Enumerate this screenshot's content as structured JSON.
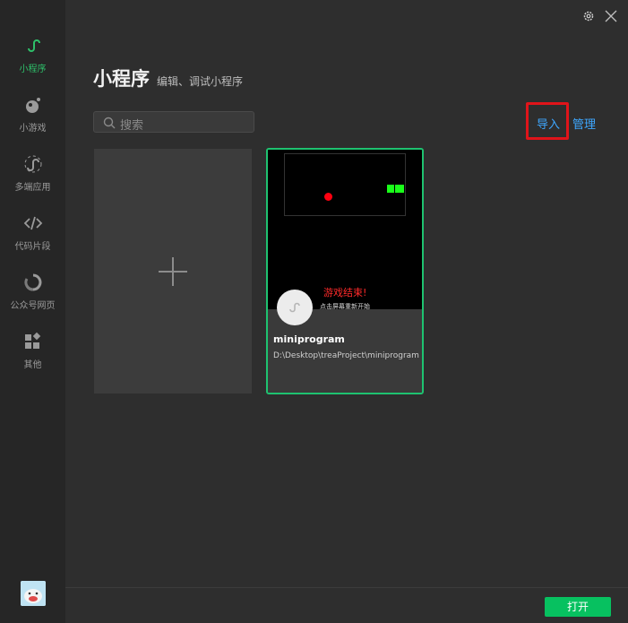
{
  "sidebar": {
    "items": [
      {
        "label": "小程序",
        "icon": "miniprogram-icon",
        "active": true
      },
      {
        "label": "小游戏",
        "icon": "minigame-icon"
      },
      {
        "label": "多端应用",
        "icon": "multiplatform-icon"
      },
      {
        "label": "代码片段",
        "icon": "code-icon"
      },
      {
        "label": "公众号网页",
        "icon": "official-account-icon"
      },
      {
        "label": "其他",
        "icon": "grid-icon"
      }
    ],
    "accent": "#2ec06a"
  },
  "header": {
    "title": "小程序",
    "subtitle": "编辑、调试小程序"
  },
  "search": {
    "placeholder": "搜索"
  },
  "actions": {
    "import_label": "导入",
    "manage_label": "管理"
  },
  "project": {
    "name": "miniprogram",
    "path": "D:\\Desktop\\treaProject\\miniprogram",
    "thumb_text": "游戏结束!",
    "thumb_subtext": "点击屏幕重新开始"
  },
  "footer": {
    "open_label": "打开"
  },
  "colors": {
    "link": "#3ea7ff",
    "primary": "#07c160",
    "highlight": "#e0141a"
  }
}
